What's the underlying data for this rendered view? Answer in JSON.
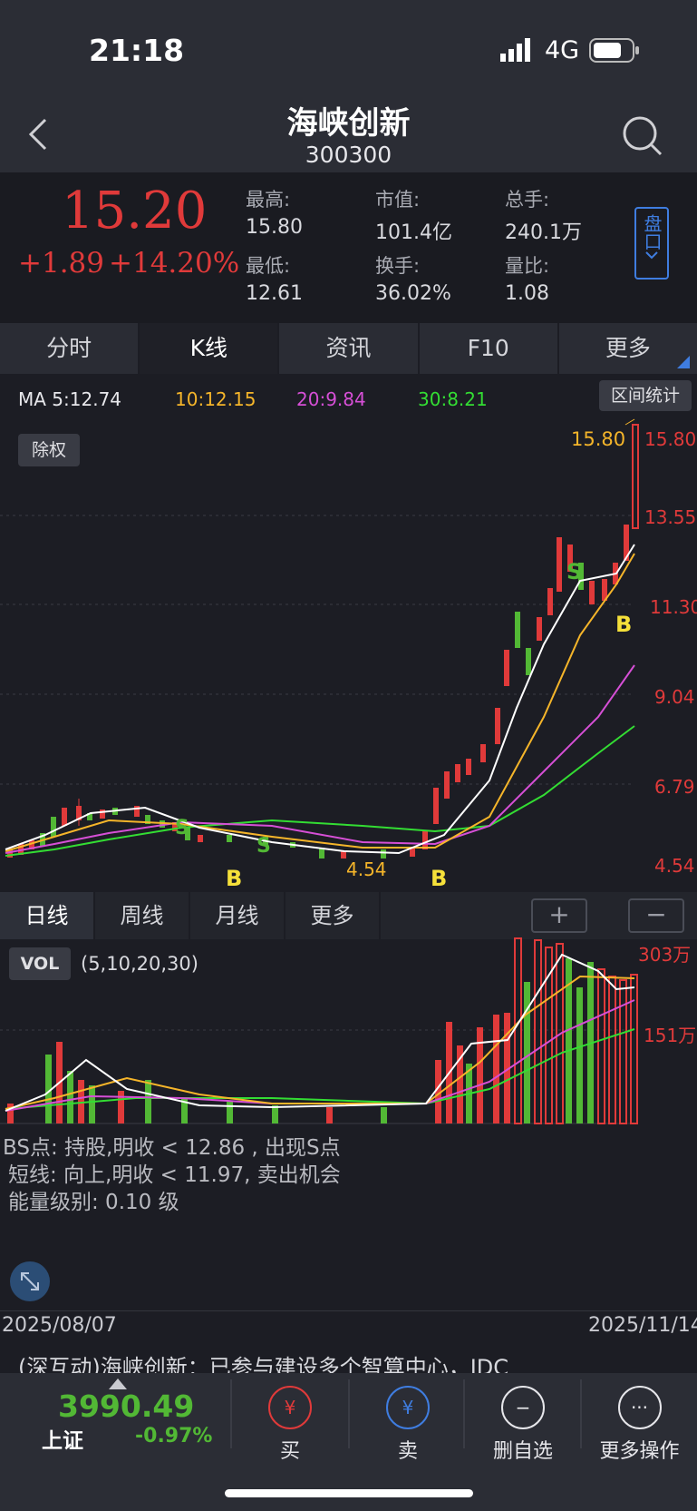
{
  "status_bar": {
    "time": "21:18",
    "network": "4G"
  },
  "header": {
    "title": "海峡创新",
    "code": "300300"
  },
  "quote": {
    "price": "15.20",
    "change": "+1.89",
    "change_pct": "+14.20%",
    "stats": [
      {
        "label": "最高:",
        "value": "15.80"
      },
      {
        "label": "市值:",
        "value": "101.4亿"
      },
      {
        "label": "总手:",
        "value": "240.1万"
      },
      {
        "label": "最低:",
        "value": "12.61"
      },
      {
        "label": "换手:",
        "value": "36.02%"
      },
      {
        "label": "量比:",
        "value": "1.08"
      }
    ],
    "pankou_label": "盘口"
  },
  "tabs": [
    "分时",
    "K线",
    "资讯",
    "F10",
    "更多"
  ],
  "ma_legend": {
    "ma5": "MA 5:12.74",
    "ma10": "10:12.15",
    "ma20": "20:9.84",
    "ma30": "30:8.21"
  },
  "range_stats_button": "区间统计",
  "exright_button": "除权",
  "price_axis": [
    "15.80",
    "13.55",
    "11.30",
    "9.04",
    "6.79",
    "4.54"
  ],
  "annotations": {
    "high": "15.80",
    "low": "4.54",
    "buy": "B",
    "sell": "S"
  },
  "period_tabs": [
    "日线",
    "周线",
    "月线",
    "更多"
  ],
  "zoom": {
    "in": "+",
    "out": "−"
  },
  "vol": {
    "label": "VOL",
    "params": "(5,10,20,30)",
    "axis_top": "303万",
    "axis_mid": "151万"
  },
  "signals": {
    "line1": "BS点: 持股,明收 < 12.86 , 出现S点",
    "line2": "短线: 向上,明收 < 11.97, 卖出机会",
    "line3": "能量级别: 0.10 级"
  },
  "dates": {
    "start": "2025/08/07",
    "end": "2025/11/14"
  },
  "news_ticker": "(深互动)海峡创新：已参与建设多个智算中心，IDC",
  "bottom": {
    "index_value": "3990.49",
    "index_name": "上证",
    "index_change": "-0.97%",
    "buy": "买",
    "sell": "卖",
    "remove_watch": "删自选",
    "more_ops": "更多操作",
    "buy_glyph": "¥",
    "sell_glyph": "¥",
    "remove_glyph": "−",
    "more_glyph": "···"
  },
  "colors": {
    "up": "#e03a3a",
    "down": "#52b835",
    "ma5": "#ffffff",
    "ma10": "#f5b52a",
    "ma20": "#d64fd6",
    "ma30": "#33dd33",
    "accent": "#3f7de0"
  }
}
